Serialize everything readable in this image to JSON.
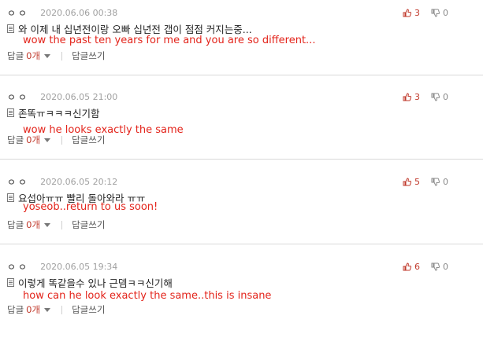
{
  "labels": {
    "reply_prefix": "답글",
    "write_reply": "답글쓰기"
  },
  "comments": [
    {
      "user": "ㅇㅇ",
      "date": "2020.06.06 00:38",
      "upvotes": "3",
      "downvotes": "0",
      "text": "와 이제 내 십년전이랑 오빠 십년전 갭이 점점 커지는중...",
      "translation": "wow the past ten years for me and you are so different...",
      "reply_count": "0개"
    },
    {
      "user": "ㅇㅇ",
      "date": "2020.06.05 21:00",
      "upvotes": "3",
      "downvotes": "0",
      "text": "존똑ㅠㅋㅋㅋ신기함",
      "translation": "wow he looks exactly the same",
      "reply_count": "0개"
    },
    {
      "user": "ㅇㅇ",
      "date": "2020.06.05 20:12",
      "upvotes": "5",
      "downvotes": "0",
      "text": "요섭아ㅠㅠ 빨리 돌아와라 ㅠㅠ",
      "translation": "yoseob..return to us soon!",
      "reply_count": "0개"
    },
    {
      "user": "ㅇㅇ",
      "date": "2020.06.05 19:34",
      "upvotes": "6",
      "downvotes": "0",
      "text": "이렇게 똑같을수 있나 근뎀ㅋㅋ신기해",
      "translation": "how can he look exactly the same..this is insane",
      "reply_count": "0개"
    }
  ],
  "colors": {
    "upvote": "#c0392b",
    "translation": "#e3241b",
    "date": "#a0a0a0",
    "divider": "#d9d9d9"
  },
  "icons": {
    "upvote": "thumbs-up-icon",
    "downvote": "thumbs-down-icon",
    "comment": "document-icon",
    "reply_toggle": "chevron-down-icon"
  }
}
